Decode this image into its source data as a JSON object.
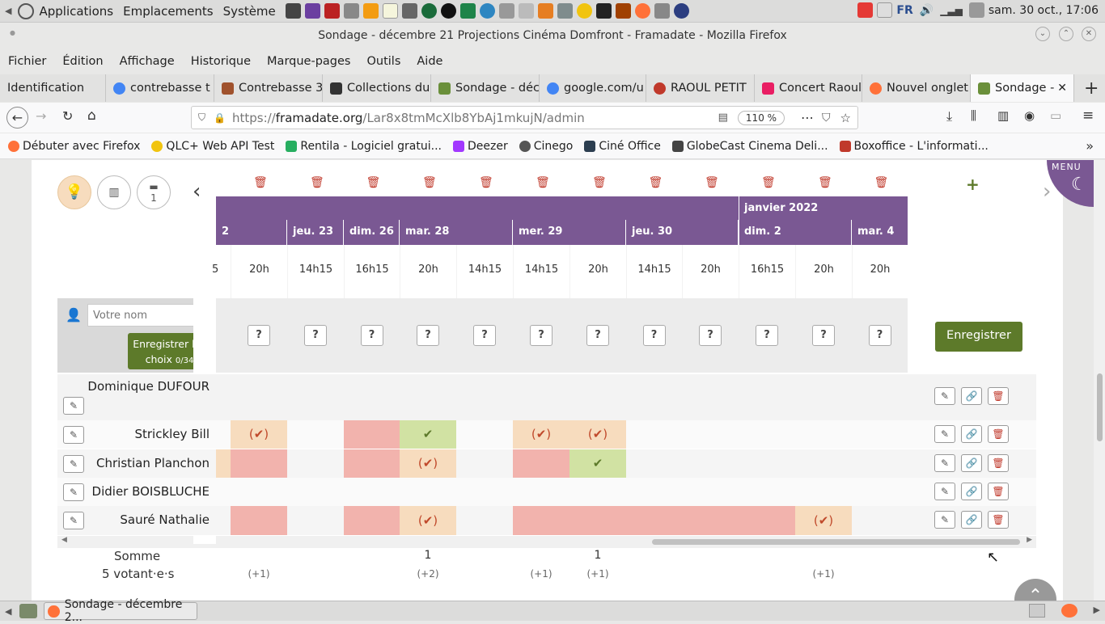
{
  "topbar": {
    "menus": [
      "Applications",
      "Emplacements",
      "Système"
    ],
    "lang": "FR",
    "datetime": "sam. 30 oct., 17:06"
  },
  "window": {
    "title": "Sondage - décembre 21 Projections Cinéma Domfront - Framadate - Mozilla Firefox"
  },
  "menubar": [
    "Fichier",
    "Édition",
    "Affichage",
    "Historique",
    "Marque-pages",
    "Outils",
    "Aide"
  ],
  "tabs": [
    {
      "label": "Identification",
      "color": "#f9f9fa"
    },
    {
      "label": "contrebasse t",
      "color": "#4285f4"
    },
    {
      "label": "Contrebasse 3",
      "color": "#a0522d"
    },
    {
      "label": "Collections du",
      "color": "#333333"
    },
    {
      "label": "Sondage - déc",
      "color": "#6a8f3a"
    },
    {
      "label": "google.com/u",
      "color": "#4285f4"
    },
    {
      "label": "RAOUL PETIT",
      "color": "#c0392b"
    },
    {
      "label": "Concert Raoul",
      "color": "#e91e63"
    },
    {
      "label": "Nouvel onglet",
      "color": "#ff7139"
    },
    {
      "label": "Sondage - ",
      "color": "#6a8f3a"
    }
  ],
  "navbar": {
    "url_prefix": "https://",
    "url_domain": "framadate.org",
    "url_path": "/Lar8x8tmMcXlb8YbAj1mkujN/admin",
    "zoom": "110 %"
  },
  "bookmarks": [
    {
      "label": "Débuter avec Firefox",
      "color": "#ff7139"
    },
    {
      "label": "QLC+ Web API Test",
      "color": "#f1c40f"
    },
    {
      "label": "Rentila - Logiciel gratui...",
      "color": "#27ae60"
    },
    {
      "label": "Deezer",
      "color": "#a238ff"
    },
    {
      "label": "Cinego",
      "color": "#555555"
    },
    {
      "label": "Ciné Office",
      "color": "#2c3e50"
    },
    {
      "label": "GlobeCast Cinema Deli...",
      "color": "#444444"
    },
    {
      "label": "Boxoffice - L'informati...",
      "color": "#c0392b"
    }
  ],
  "poll": {
    "menu_label": "MENU",
    "comment_count": "1",
    "month_label": "janvier 2022",
    "days": [
      {
        "label": "2"
      },
      {
        "label": "jeu. 23"
      },
      {
        "label": "dim. 26"
      },
      {
        "label": "mar. 28"
      },
      {
        "label": "mer. 29"
      },
      {
        "label": "jeu. 30"
      },
      {
        "label": "dim. 2"
      },
      {
        "label": "mar. 4"
      }
    ],
    "times": [
      "5",
      "20h",
      "14h15",
      "16h15",
      "20h",
      "14h15",
      "14h15",
      "20h",
      "14h15",
      "20h",
      "16h15",
      "20h",
      "20h"
    ],
    "name_placeholder": "Votre nom",
    "save_choices_label": "Enregistrer les choix",
    "save_choices_count": "0/34",
    "save_label": "Enregistrer",
    "voters": [
      {
        "name": "Dominique DUFOUR",
        "cells": [
          "",
          "",
          "",
          "",
          "",
          "",
          "",
          "",
          "",
          "",
          "",
          "",
          ""
        ]
      },
      {
        "name": "Strickley Bill",
        "cells": [
          "",
          "maybe",
          "",
          "no",
          "yes",
          "",
          "maybe",
          "maybe",
          "",
          "",
          "",
          "",
          ""
        ]
      },
      {
        "name": "Christian Planchon",
        "cells": [
          "maybe",
          "no",
          "",
          "no",
          "maybe",
          "",
          "no",
          "yes",
          "",
          "",
          "",
          "",
          ""
        ]
      },
      {
        "name": "Didier BOISBLUCHE",
        "cells": [
          "",
          "",
          "",
          "",
          "",
          "",
          "",
          "",
          "",
          "",
          "",
          "",
          ""
        ]
      },
      {
        "name": "Sauré Nathalie",
        "cells": [
          "",
          "no",
          "",
          "no",
          "maybe",
          "",
          "no",
          "no",
          "no",
          "no",
          "no",
          "maybe",
          ""
        ]
      }
    ],
    "sum_label": "Somme",
    "voters_label": "5 votant·e·s",
    "sums": [
      "",
      "",
      "",
      "",
      "1",
      "",
      "",
      "1",
      "",
      "",
      "",
      "",
      ""
    ],
    "plus": [
      "",
      "(+1)",
      "",
      "",
      "(+2)",
      "",
      "(+1)",
      "(+1)",
      "",
      "",
      "",
      "(+1)",
      ""
    ]
  },
  "statusbar": {
    "task": "Sondage - décembre 2..."
  },
  "colors": {
    "purple": "#7a5893",
    "yes": "#d1e2a3",
    "no": "#f2b3ad",
    "maybe": "#f7dcbe",
    "green_btn": "#5d7a2a",
    "check": "#5d7a2a",
    "maybe_check": "#c0492b"
  }
}
